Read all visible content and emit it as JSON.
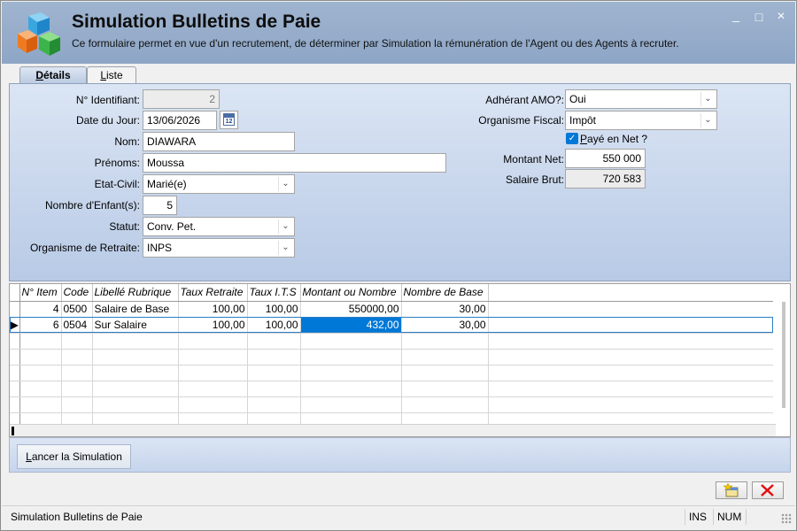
{
  "header": {
    "title": "Simulation Bulletins de Paie",
    "subtitle": "Ce formulaire permet en vue d'un recrutement, de déterminer par Simulation la rémunération de l'Agent ou des Agents à recruter."
  },
  "window_controls": {
    "minimize": "_",
    "maximize": "□",
    "close": "×"
  },
  "tabs": [
    {
      "label_u": "D",
      "label_rest": "étails",
      "active": true
    },
    {
      "label_u": "L",
      "label_rest": "iste",
      "active": false
    }
  ],
  "form": {
    "id": {
      "label": "N° Identifiant:",
      "value": "2"
    },
    "date": {
      "label": "Date du Jour:",
      "value": "13/06/2026",
      "cal": "12"
    },
    "nom": {
      "label": "Nom:",
      "value": "DIAWARA"
    },
    "prenoms": {
      "label": "Prénoms:",
      "value": "Moussa"
    },
    "etat_civil": {
      "label": "Etat-Civil:",
      "value": "Marié(e)"
    },
    "enfants": {
      "label": "Nombre d'Enfant(s):",
      "value": "5"
    },
    "statut": {
      "label": "Statut:",
      "value": "Conv. Pet."
    },
    "retraite": {
      "label": "Organisme de Retraite:",
      "value": "INPS"
    },
    "amo": {
      "label": "Adhérant AMO?:",
      "value": "Oui"
    },
    "fiscal": {
      "label": "Organisme Fiscal:",
      "value": "Impôt"
    },
    "paye_net": {
      "label_u": "P",
      "label_rest": "ayé en Net ?",
      "checked": true
    },
    "montant_net": {
      "label": "Montant Net:",
      "value": "550 000"
    },
    "salaire_brut": {
      "label": "Salaire Brut:",
      "value": "720 583"
    }
  },
  "grid": {
    "columns": [
      "N° Item",
      "Code",
      "Libellé Rubrique",
      "Taux Retraite",
      "Taux I.T.S",
      "Montant ou Nombre",
      "Nombre de Base"
    ],
    "rows": [
      [
        "4",
        "0500",
        "Salaire de Base",
        "100,00",
        "100,00",
        "550000,00",
        "30,00"
      ],
      [
        "6",
        "0504",
        "Sur Salaire",
        "100,00",
        "100,00",
        "432,00",
        "30,00"
      ]
    ],
    "selected_row": 1,
    "highlight_color": "#0078d7"
  },
  "buttons": {
    "launch_u": "L",
    "launch_rest": "ancer la Simulation"
  },
  "status": {
    "text": "Simulation Bulletins de Paie",
    "ins": "INS",
    "num": "NUM"
  }
}
